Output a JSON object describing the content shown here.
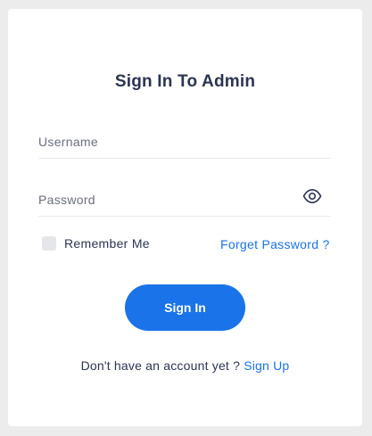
{
  "form": {
    "title": "Sign In To Admin",
    "username_placeholder": "Username",
    "password_placeholder": "Password",
    "remember_label": "Remember Me",
    "remember_checked": false,
    "forget_label": "Forget Password ?",
    "submit_label": "Sign In",
    "footer_text": "Don't have an account yet ?",
    "signup_label": "Sign Up"
  },
  "icons": {
    "password_toggle": "eye-icon"
  },
  "colors": {
    "accent": "#1a73e8",
    "text": "#2d3452",
    "background": "#ececec",
    "card": "#ffffff"
  }
}
